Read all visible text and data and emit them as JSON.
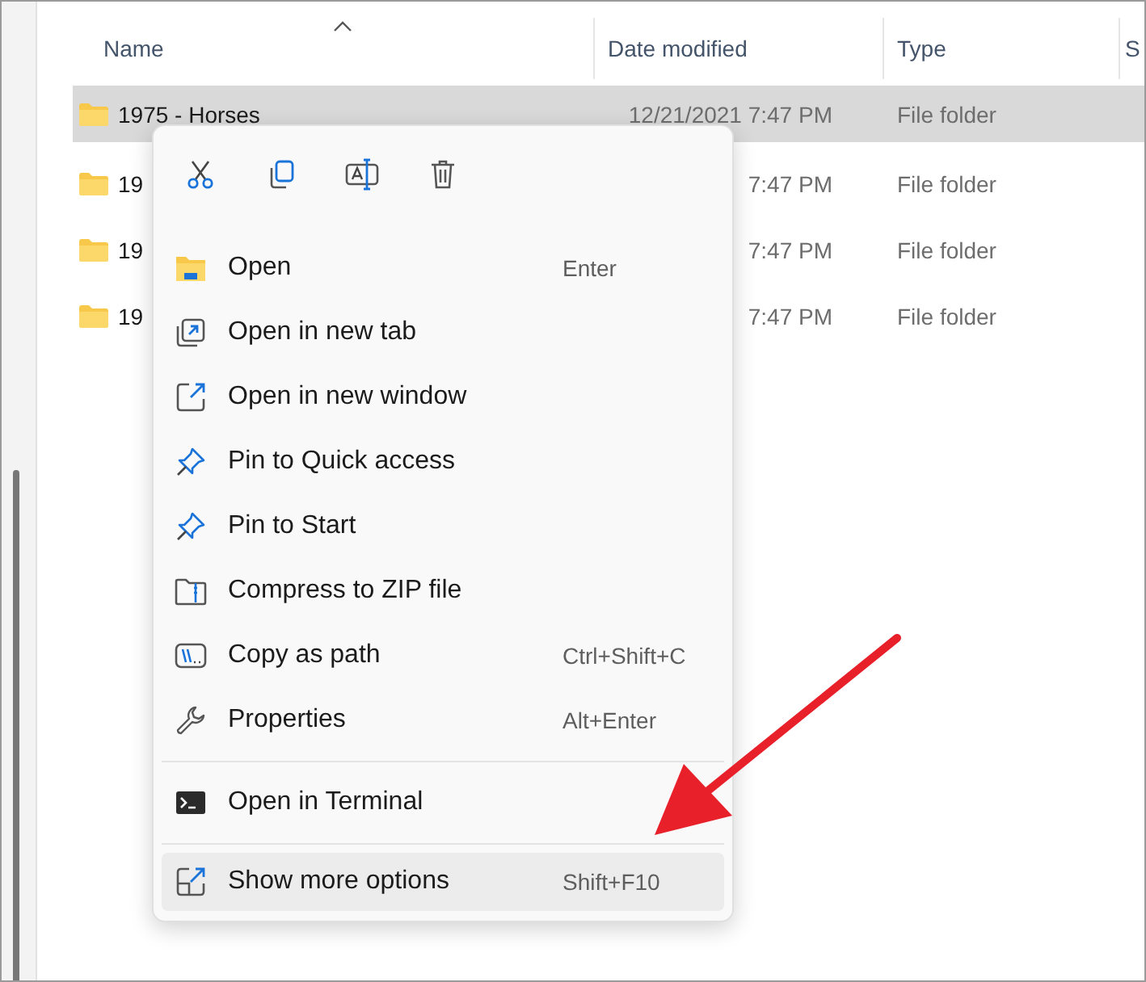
{
  "columns": [
    {
      "label": "Name"
    },
    {
      "label": "Date modified"
    },
    {
      "label": "Type"
    },
    {
      "label": "S"
    }
  ],
  "rows": [
    {
      "name": "1975 - Horses",
      "date": "12/21/2021 7:47 PM",
      "type": "File folder",
      "selected": true
    },
    {
      "name": "19",
      "date": "7:47 PM",
      "type": "File folder",
      "selected": false
    },
    {
      "name": "19",
      "date": "7:47 PM",
      "type": "File folder",
      "selected": false
    },
    {
      "name": "19",
      "date": "7:47 PM",
      "type": "File folder",
      "selected": false
    }
  ],
  "menu": {
    "toolbar": [
      {
        "kind": "cut"
      },
      {
        "kind": "copy"
      },
      {
        "kind": "rename"
      },
      {
        "kind": "delete"
      }
    ],
    "items": [
      {
        "kind": "open",
        "label": "Open",
        "shortcut": "Enter",
        "selected": false,
        "separator_before": false
      },
      {
        "kind": "newtab",
        "label": "Open in new tab",
        "selected": false,
        "separator_before": false
      },
      {
        "kind": "newwindow",
        "label": "Open in new window",
        "selected": false,
        "separator_before": false
      },
      {
        "kind": "pin",
        "label": "Pin to Quick access",
        "selected": false,
        "separator_before": false
      },
      {
        "kind": "pin",
        "label": "Pin to Start",
        "selected": false,
        "separator_before": false
      },
      {
        "kind": "zip",
        "label": "Compress to ZIP file",
        "selected": false,
        "separator_before": false
      },
      {
        "kind": "path",
        "label": "Copy as path",
        "shortcut": "Ctrl+Shift+C",
        "selected": false,
        "separator_before": false
      },
      {
        "kind": "wrench",
        "label": "Properties",
        "shortcut": "Alt+Enter",
        "selected": false,
        "separator_before": false
      },
      {
        "kind": "terminal",
        "label": "Open in Terminal",
        "selected": false,
        "separator_before": true
      },
      {
        "kind": "more",
        "label": "Show more options",
        "shortcut": "Shift+F10",
        "selected": true,
        "separator_before": true
      }
    ]
  }
}
